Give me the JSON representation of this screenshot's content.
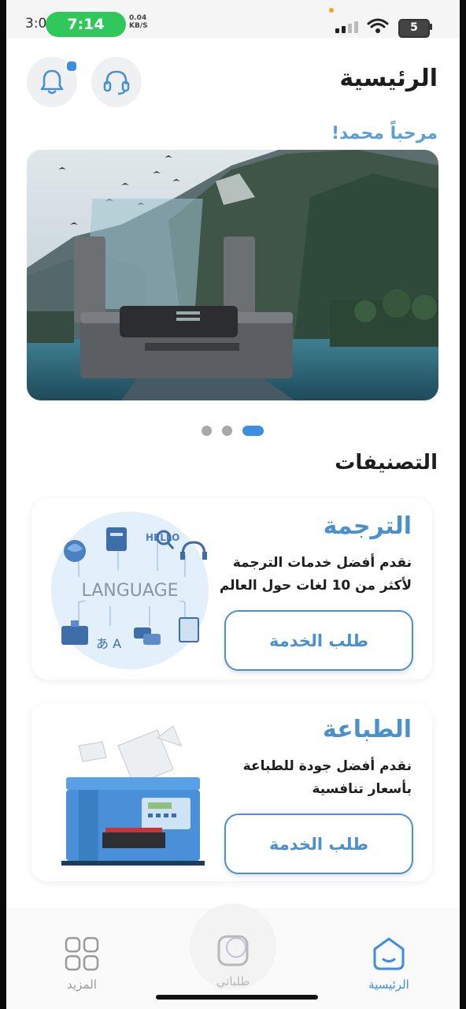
{
  "status_bar": {
    "time_left": "3:0",
    "time_pill": "7:14",
    "net_speed": "0.04",
    "net_unit": "KB/S",
    "battery": "5"
  },
  "header": {
    "title": "الرئيسية",
    "greeting": "مرحباً محمد!",
    "notification_icon": "bell-icon",
    "support_icon": "headset-icon"
  },
  "carousel": {
    "page_count": 3,
    "active_page": 3
  },
  "categories": {
    "title": "التصنيفات",
    "items": [
      {
        "title": "الترجمة",
        "description": "نقدم أفضل خدمات الترجمة لأكثر من 10 لغات حول العالم",
        "button": "طلب الخدمة",
        "illustration_text": "LANGUAGE",
        "illustration_hello": "HELLO"
      },
      {
        "title": "الطباعة",
        "description": "نقدم أفضل جودة للطباعة بأسعار تنافسية",
        "button": "طلب الخدمة"
      }
    ]
  },
  "nav": {
    "items": [
      {
        "label": "المزيد",
        "icon": "grid-icon"
      },
      {
        "label": "طلباتي",
        "icon": "orders-icon"
      },
      {
        "label": "الرئيسية",
        "icon": "home-icon"
      }
    ]
  },
  "colors": {
    "accent": "#4a90cf",
    "active_dot": "#3c8fe0",
    "time_pill": "#30c85a"
  }
}
